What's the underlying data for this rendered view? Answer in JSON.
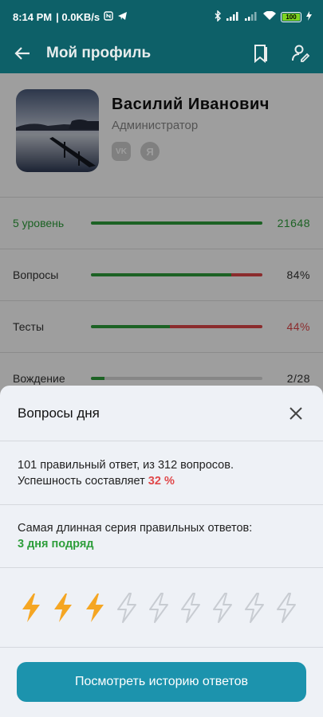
{
  "status_bar": {
    "time": "8:14 PM",
    "network_speed": "| 0.0KB/s",
    "battery": "100",
    "icons": [
      "nfc-icon",
      "telegram-icon",
      "bluetooth-icon",
      "signal-icon",
      "signal-icon",
      "wifi-icon",
      "battery-icon",
      "charging-icon"
    ]
  },
  "app_bar": {
    "title": "Мой профиль",
    "icons": [
      "back-arrow-icon",
      "bookmark-icon",
      "edit-profile-icon"
    ]
  },
  "profile": {
    "name": "Василий Иванович",
    "role": "Администратор",
    "socials": [
      "VK",
      "Я"
    ]
  },
  "stats": [
    {
      "label": "5 уровень",
      "value": "21648",
      "progress_green": 1.0,
      "progress_red": 0.0,
      "label_color": "green",
      "value_color": "green"
    },
    {
      "label": "Вопросы",
      "value": "84%",
      "progress_green": 0.82,
      "progress_red": 0.18,
      "label_color": "default",
      "value_color": "default"
    },
    {
      "label": "Тесты",
      "value": "44%",
      "progress_green": 0.46,
      "progress_red": 0.54,
      "label_color": "default",
      "value_color": "red"
    },
    {
      "label": "Вождение",
      "value": "2/28",
      "progress_green": 0.08,
      "progress_red": 0.0,
      "label_color": "default",
      "value_color": "default"
    }
  ],
  "sheet": {
    "title": "Вопросы дня",
    "summary_line1": "101 правильный ответ, из 312 вопросов.",
    "summary_line2_prefix": "Успешность составляет",
    "success_rate": "32 %",
    "streak_label": "Самая длинная серия правильных ответов:",
    "streak_value": "3 дня подряд",
    "bolts_filled": 3,
    "bolts_total": 9,
    "button_label": "Посмотреть историю ответов"
  },
  "colors": {
    "header": "#0d6068",
    "green": "#2e9e3b",
    "red": "#e0484a",
    "bolt_active": "#f5a623",
    "bolt_inactive": "#c8ccd2",
    "button": "#1c93ad"
  }
}
